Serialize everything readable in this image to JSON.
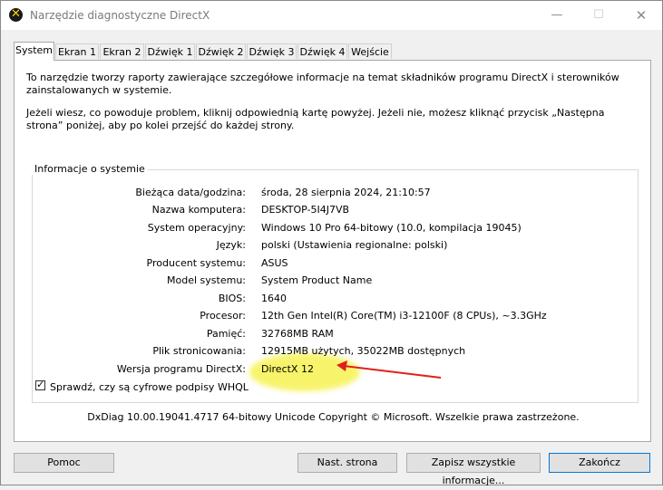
{
  "window": {
    "title": "Narzędzie diagnostyczne DirectX"
  },
  "controls": {
    "minimize": "—",
    "maximize": "☐",
    "close": "✕"
  },
  "tabs": [
    {
      "label": "System"
    },
    {
      "label": "Ekran 1"
    },
    {
      "label": "Ekran 2"
    },
    {
      "label": "Dźwięk 1"
    },
    {
      "label": "Dźwięk 2"
    },
    {
      "label": "Dźwięk 3"
    },
    {
      "label": "Dźwięk 4"
    },
    {
      "label": "Wejście"
    }
  ],
  "intro": {
    "p1": "To narzędzie tworzy raporty zawierające szczegółowe informacje na temat składników programu DirectX i sterowników zainstalowanych w systemie.",
    "p2": "Jeżeli wiesz, co powoduje problem, kliknij odpowiednią kartę powyżej. Jeżeli nie, możesz kliknąć przycisk „Następna strona” poniżej, aby po kolei przejść do każdej strony."
  },
  "sysinfo": {
    "title": "Informacje o systemie",
    "rows": [
      {
        "label": "Bieżąca data/godzina:",
        "value": "środa, 28 sierpnia 2024, 21:10:57"
      },
      {
        "label": "Nazwa komputera:",
        "value": "DESKTOP-5I4J7VB"
      },
      {
        "label": "System operacyjny:",
        "value": "Windows 10 Pro 64-bitowy (10.0, kompilacja 19045)"
      },
      {
        "label": "Język:",
        "value": "polski (Ustawienia regionalne: polski)"
      },
      {
        "label": "Producent systemu:",
        "value": "ASUS"
      },
      {
        "label": "Model systemu:",
        "value": "System Product Name"
      },
      {
        "label": "BIOS:",
        "value": "1640"
      },
      {
        "label": "Procesor:",
        "value": "12th Gen Intel(R) Core(TM) i3-12100F (8 CPUs), ~3.3GHz"
      },
      {
        "label": "Pamięć:",
        "value": "32768MB RAM"
      },
      {
        "label": "Plik stronicowania:",
        "value": "12915MB użytych, 35022MB dostępnych"
      },
      {
        "label": "Wersja programu DirectX:",
        "value": "DirectX 12"
      }
    ]
  },
  "whql_checkbox": {
    "label": "Sprawdź, czy są cyfrowe podpisy WHQL",
    "checked": true
  },
  "footer": "DxDiag 10.00.19041.4717 64-bitowy Unicode  Copyright © Microsoft. Wszelkie prawa zastrzeżone.",
  "buttons": {
    "help": "Pomoc",
    "next": "Nast. strona",
    "save": "Zapisz wszystkie informacje...",
    "exit": "Zakończ"
  },
  "annotation": {
    "highlight_color": "#f5f13a",
    "arrow_color": "#e0201b"
  }
}
